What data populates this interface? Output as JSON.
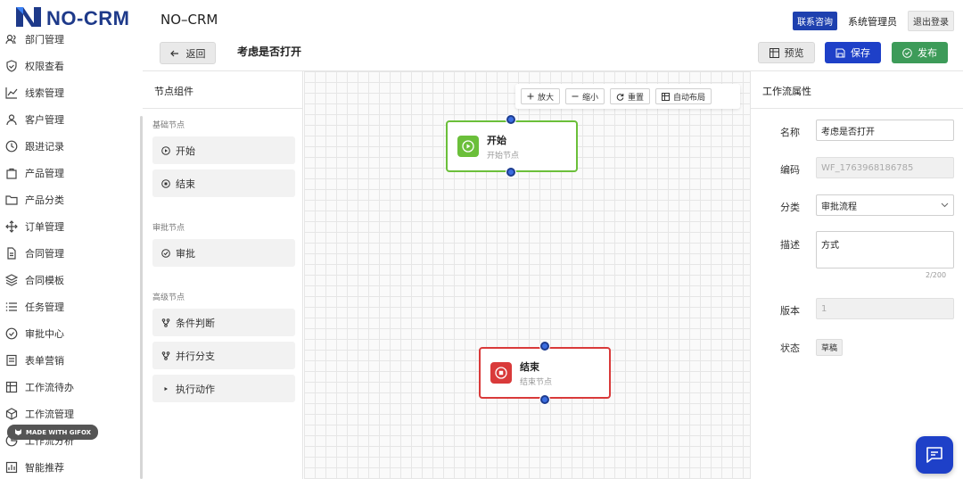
{
  "header": {
    "logo_text": "NO-CRM",
    "app_title": "NO–CRM",
    "contact_label": "联系咨询",
    "admin_name": "系统管理员",
    "logout_label": "退出登录"
  },
  "sidebar": {
    "items": [
      {
        "label": "部门管理",
        "icon": "users-icon"
      },
      {
        "label": "权限查看",
        "icon": "shield-icon"
      },
      {
        "label": "线索管理",
        "icon": "trend-icon"
      },
      {
        "label": "客户管理",
        "icon": "user-icon"
      },
      {
        "label": "跟进记录",
        "icon": "clock-icon"
      },
      {
        "label": "产品管理",
        "icon": "bag-icon"
      },
      {
        "label": "产品分类",
        "icon": "folder-icon"
      },
      {
        "label": "订单管理",
        "icon": "move-icon"
      },
      {
        "label": "合同管理",
        "icon": "file-icon"
      },
      {
        "label": "合同模板",
        "icon": "layers-icon"
      },
      {
        "label": "任务管理",
        "icon": "list-icon"
      },
      {
        "label": "审批中心",
        "icon": "check-circle-icon"
      },
      {
        "label": "表单营销",
        "icon": "form-icon"
      },
      {
        "label": "工作流待办",
        "icon": "grid-icon"
      },
      {
        "label": "工作流管理",
        "icon": "cube-icon"
      },
      {
        "label": "工作流分析",
        "icon": "pie-icon"
      },
      {
        "label": "智能推荐",
        "icon": "chart-icon"
      }
    ],
    "gifox_badge": "MADE WITH GIFOX"
  },
  "toolbar": {
    "back_label": "返回",
    "workflow_title": "考虑是否打开",
    "preview_label": "预览",
    "save_label": "保存",
    "publish_label": "发布"
  },
  "nodes_panel": {
    "title": "节点组件",
    "groups": [
      {
        "label": "基础节点",
        "items": [
          {
            "label": "开始",
            "icon": "play-circle-icon"
          },
          {
            "label": "结束",
            "icon": "stop-circle-icon"
          }
        ]
      },
      {
        "label": "审批节点",
        "items": [
          {
            "label": "审批",
            "icon": "check-circle-icon"
          }
        ]
      },
      {
        "label": "高级节点",
        "items": [
          {
            "label": "条件判断",
            "icon": "branch-icon"
          },
          {
            "label": "并行分支",
            "icon": "branch-icon"
          },
          {
            "label": "执行动作",
            "icon": "play-icon"
          }
        ]
      }
    ]
  },
  "canvas": {
    "tools": [
      {
        "label": "放大",
        "icon": "plus-icon"
      },
      {
        "label": "缩小",
        "icon": "minus-icon"
      },
      {
        "label": "重置",
        "icon": "refresh-icon"
      },
      {
        "label": "自动布局",
        "icon": "grid-icon"
      }
    ],
    "nodes": [
      {
        "title": "开始",
        "subtitle": "开始节点",
        "color": "#6bbf3a"
      },
      {
        "title": "结束",
        "subtitle": "结束节点",
        "color": "#d93a3a"
      }
    ]
  },
  "properties": {
    "title": "工作流属性",
    "name_label": "名称",
    "name_value": "考虑是否打开",
    "code_label": "编码",
    "code_value": "WF_1763968186785",
    "category_label": "分类",
    "category_value": "审批流程",
    "desc_label": "描述",
    "desc_value": "方式",
    "desc_counter": "2/200",
    "version_label": "版本",
    "version_value": "1",
    "status_label": "状态",
    "status_value": "草稿"
  },
  "colors": {
    "primary": "#1e40c8",
    "success": "#3d9b59",
    "start_node": "#6bbf3a",
    "end_node": "#d93a3a",
    "handle": "#3b6de0"
  }
}
